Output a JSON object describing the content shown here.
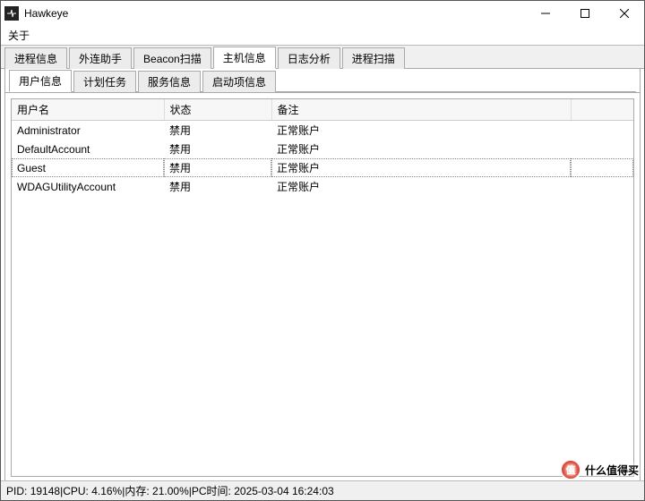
{
  "window": {
    "title": "Hawkeye"
  },
  "menu": {
    "about": "关于"
  },
  "main_tabs": [
    {
      "label": "进程信息"
    },
    {
      "label": "外连助手"
    },
    {
      "label": "Beacon扫描"
    },
    {
      "label": "主机信息",
      "active": true
    },
    {
      "label": "日志分析"
    },
    {
      "label": "进程扫描"
    }
  ],
  "sub_tabs": [
    {
      "label": "用户信息",
      "active": true
    },
    {
      "label": "计划任务"
    },
    {
      "label": "服务信息"
    },
    {
      "label": "启动项信息"
    }
  ],
  "table": {
    "headers": {
      "user": "用户名",
      "status": "状态",
      "remark": "备注"
    },
    "rows": [
      {
        "user": "Administrator",
        "status": "禁用",
        "remark": "正常账户",
        "selected": false
      },
      {
        "user": "DefaultAccount",
        "status": "禁用",
        "remark": "正常账户",
        "selected": false
      },
      {
        "user": "Guest",
        "status": "禁用",
        "remark": "正常账户",
        "selected": true
      },
      {
        "user": "WDAGUtilityAccount",
        "status": "禁用",
        "remark": "正常账户",
        "selected": false
      }
    ]
  },
  "status": {
    "pid_label": "PID:",
    "pid_value": "19148",
    "cpu_label": "CPU:",
    "cpu_value": "4.16%",
    "mem_label": "内存:",
    "mem_value": "21.00%",
    "time_label": "PC时间:",
    "time_value": "2025-03-04 16:24:03",
    "sep": " | "
  },
  "watermark": {
    "badge": "值",
    "text": "什么值得买"
  }
}
